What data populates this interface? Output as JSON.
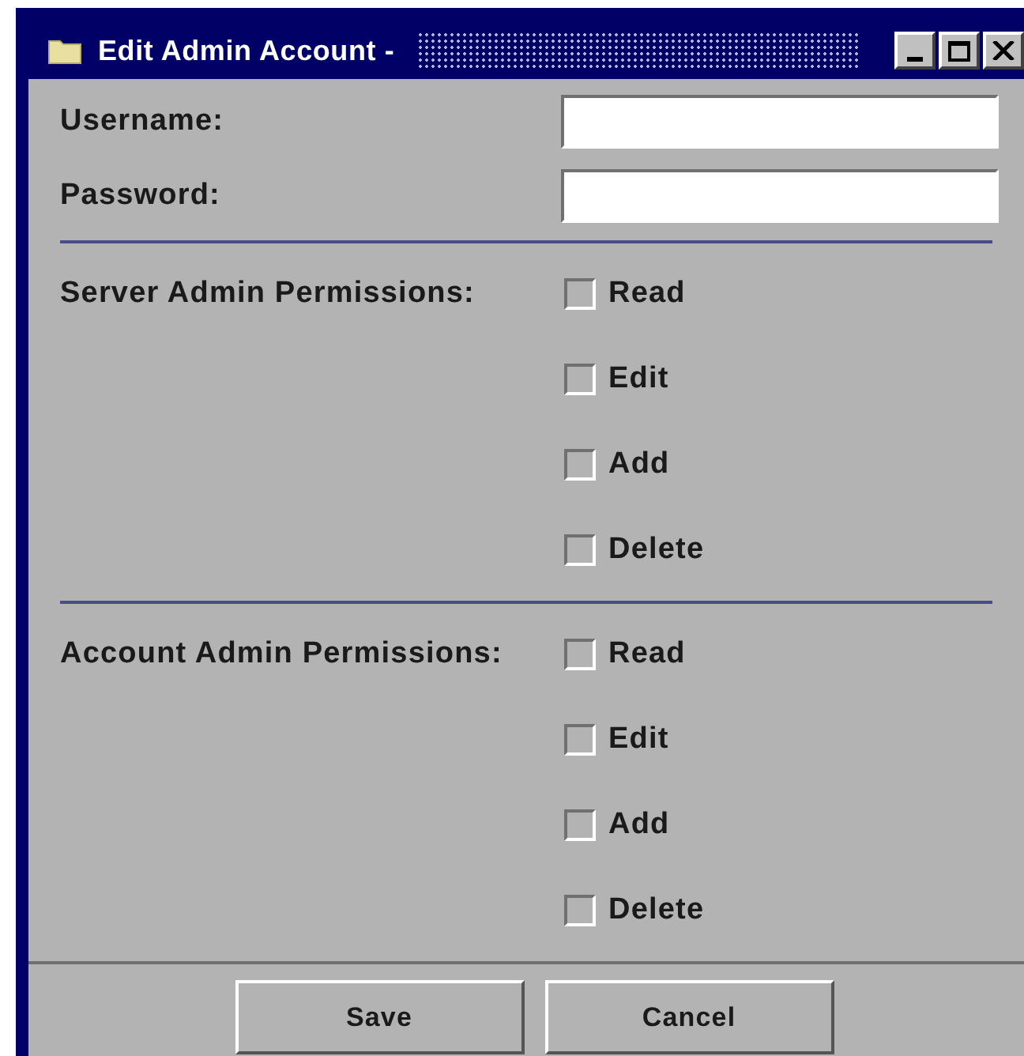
{
  "window": {
    "title": "Edit Admin Account -"
  },
  "fields": [
    {
      "label": "Username:"
    },
    {
      "label": "Password:"
    }
  ],
  "permission_groups": [
    {
      "label": "Server Admin Permissions:",
      "options": [
        {
          "label": "Read",
          "checked": false
        },
        {
          "label": "Edit",
          "checked": false
        },
        {
          "label": "Add",
          "checked": false
        },
        {
          "label": "Delete",
          "checked": false
        }
      ]
    },
    {
      "label": "Account Admin Permissions:",
      "options": [
        {
          "label": "Read",
          "checked": false
        },
        {
          "label": "Edit",
          "checked": false
        },
        {
          "label": "Add",
          "checked": false
        },
        {
          "label": "Delete",
          "checked": false
        }
      ]
    }
  ],
  "buttons": [
    "Save",
    "Cancel"
  ]
}
